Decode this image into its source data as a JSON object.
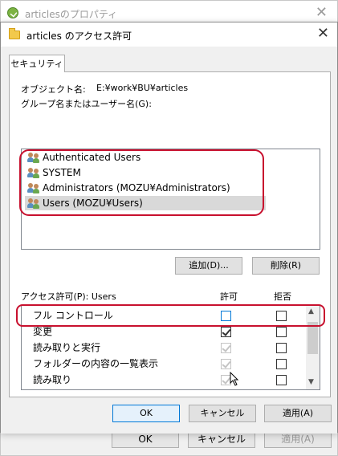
{
  "background_window": {
    "title": "articlesのプロパティ",
    "buttons": {
      "ok": "OK",
      "cancel": "キャンセル",
      "apply": "適用(A)"
    }
  },
  "dialog": {
    "title": "articles のアクセス許可",
    "tab": "セキュリティ",
    "object_name_label": "オブジェクト名:",
    "object_name_value": "E:¥work¥BU¥articles",
    "group_label": "グループ名またはユーザー名(G):",
    "users": [
      {
        "name": "Authenticated Users",
        "icon": "users-icon"
      },
      {
        "name": "SYSTEM",
        "icon": "users-icon"
      },
      {
        "name": "Administrators (MOZU¥Administrators)",
        "icon": "users-icon"
      },
      {
        "name": "Users (MOZU¥Users)",
        "icon": "users-icon",
        "selected": true
      }
    ],
    "add_button": "追加(D)...",
    "remove_button": "削除(R)",
    "permissions_label": "アクセス許可(P): Users",
    "allow_header": "許可",
    "deny_header": "拒否",
    "permissions": [
      {
        "name": "フル コントロール",
        "allow": false,
        "allow_inherited": false,
        "deny": false
      },
      {
        "name": "変更",
        "allow": true,
        "allow_inherited": false,
        "deny": false
      },
      {
        "name": "読み取りと実行",
        "allow": true,
        "allow_inherited": true,
        "deny": false
      },
      {
        "name": "フォルダーの内容の一覧表示",
        "allow": true,
        "allow_inherited": true,
        "deny": false
      },
      {
        "name": "読み取り",
        "allow": true,
        "allow_inherited": true,
        "deny": false
      }
    ],
    "buttons": {
      "ok": "OK",
      "cancel": "キャンセル",
      "apply": "適用(A)"
    }
  },
  "colors": {
    "highlight": "#c8102e",
    "selection": "#d9d9d9",
    "accent_border": "#0078d7"
  }
}
